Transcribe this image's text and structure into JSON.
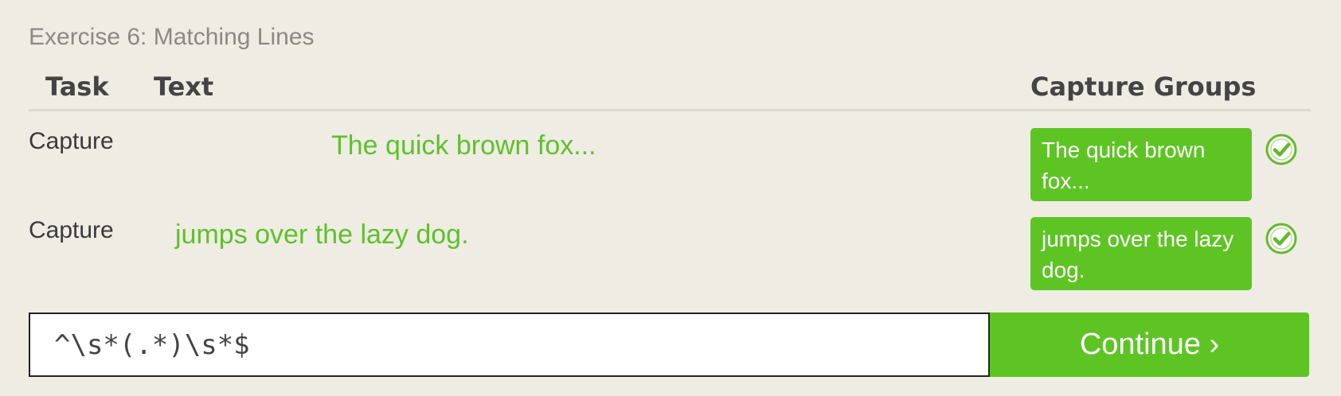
{
  "exercise": {
    "title": "Exercise 6: Matching Lines"
  },
  "table": {
    "headers": {
      "task": "Task",
      "text": "Text",
      "capture_groups": "Capture Groups"
    },
    "rows": [
      {
        "task": "Capture",
        "text": "The quick brown fox...",
        "capture": "The quick brown fox...",
        "status": "matched"
      },
      {
        "task": "Capture",
        "text": "jumps over the lazy dog.",
        "capture": "jumps over the lazy dog.",
        "status": "matched"
      }
    ]
  },
  "input": {
    "value": "^\\s*(.*)\\s*$"
  },
  "continue_button": {
    "label": "Continue ›"
  },
  "icons": {
    "row_status": "check-circle-icon"
  },
  "colors": {
    "accent_green": "#5ec424",
    "text_green": "#5ec12a",
    "background": "#efece4"
  }
}
